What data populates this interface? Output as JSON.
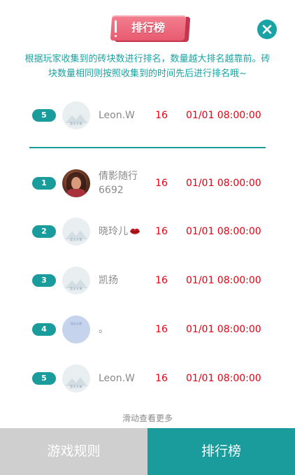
{
  "header": {
    "title": "排行榜"
  },
  "description": "根据玩家收集到的砖块数进行排名，数量越大排名越靠前。砖块数量相同则按照收集到的时间先后进行排名哦~",
  "current_user": {
    "rank": "5",
    "name": "Leon.W",
    "score": "16",
    "time": "01/01 08:00:00"
  },
  "leaderboard": [
    {
      "rank": "1",
      "name": "倩影随行6692",
      "score": "16",
      "time": "01/01 08:00:00"
    },
    {
      "rank": "2",
      "name": "晓玲儿",
      "score": "16",
      "time": "01/01 08:00:00"
    },
    {
      "rank": "3",
      "name": "凯扬",
      "score": "16",
      "time": "01/01 08:00:00"
    },
    {
      "rank": "4",
      "name": "。",
      "score": "16",
      "time": "01/01 08:00:00"
    },
    {
      "rank": "5",
      "name": "Leon.W",
      "score": "16",
      "time": "01/01 08:00:00"
    }
  ],
  "scroll_hint": "滑动查看更多",
  "tabs": {
    "rules": "游戏规则",
    "rank": "排行榜"
  },
  "colors": {
    "accent": "#1a9b9c",
    "highlight": "#e60012",
    "title_ribbon": "#e85a70",
    "inactive_tab": "#cfcfcf"
  }
}
